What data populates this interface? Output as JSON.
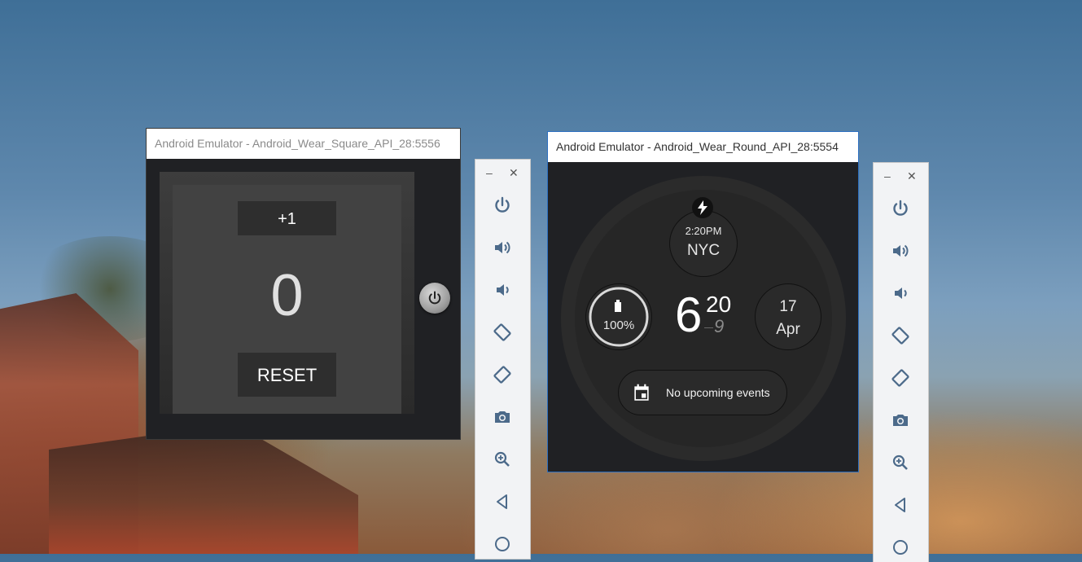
{
  "desktop": {
    "background": "photo of village rooftops at dusk"
  },
  "square_emulator": {
    "title": "Android Emulator - Android_Wear_Square_API_28:5556",
    "app": {
      "plus_label": "+1",
      "count": "0",
      "reset_label": "RESET"
    },
    "hardware_button_icon": "power-icon"
  },
  "round_emulator": {
    "title": "Android Emulator - Android_Wear_Round_API_28:5554",
    "watchface": {
      "nyc_time": "2:20PM",
      "nyc_city": "NYC",
      "battery": "100%",
      "hour": "6",
      "minute": "20",
      "second": "9",
      "date_day": "17",
      "date_month": "Apr",
      "events": "No upcoming events"
    }
  },
  "toolbar": {
    "minimize": "–",
    "close": "✕",
    "buttons": [
      {
        "icon": "power-icon"
      },
      {
        "icon": "volume-up-icon"
      },
      {
        "icon": "volume-down-icon"
      },
      {
        "icon": "rotate-left-icon"
      },
      {
        "icon": "rotate-right-icon"
      },
      {
        "icon": "camera-icon"
      },
      {
        "icon": "zoom-icon"
      },
      {
        "icon": "back-icon"
      },
      {
        "icon": "home-icon"
      }
    ]
  },
  "colors": {
    "icon_blue": "#4c6a8a",
    "window_active_border": "#2d6fc0",
    "watch_bg": "#202124"
  }
}
